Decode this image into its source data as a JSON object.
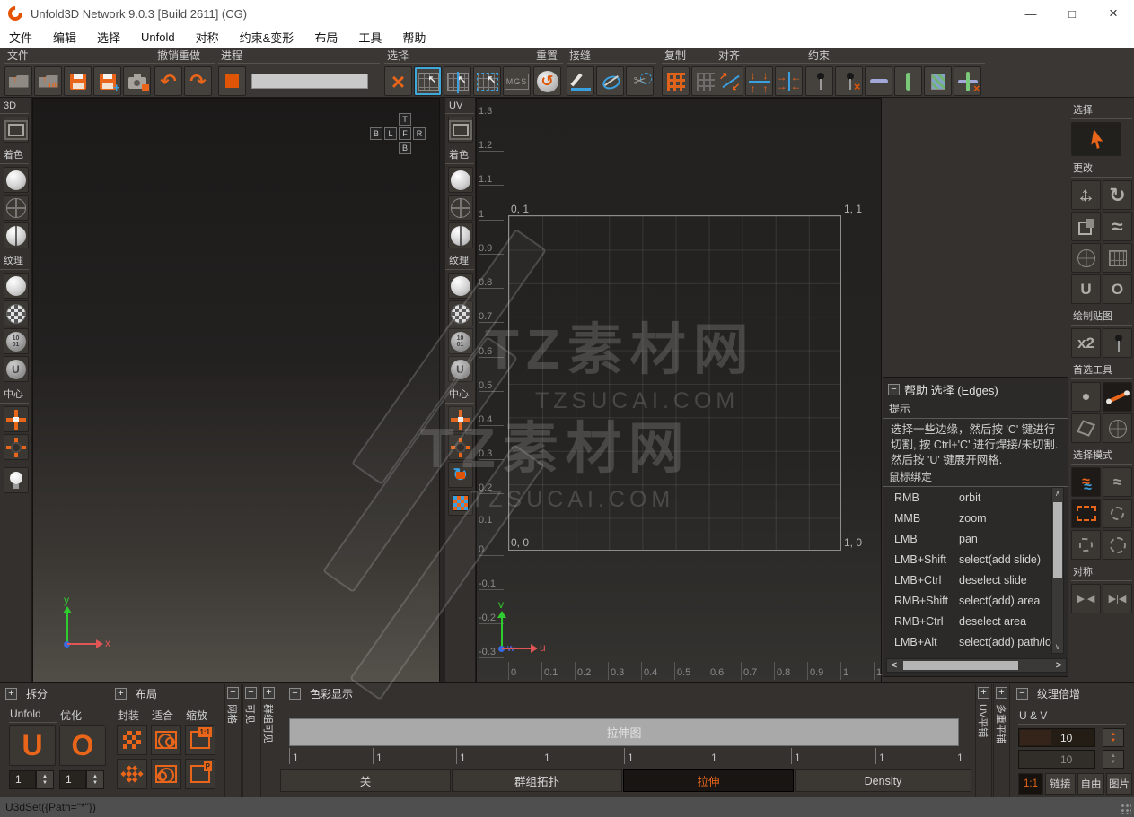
{
  "window": {
    "title": "Unfold3D Network 9.0.3 [Build 2611] (CG)",
    "minimize": "—",
    "maximize": "□",
    "close": "×"
  },
  "menubar": {
    "items": [
      "文件",
      "编辑",
      "选择",
      "Unfold",
      "对称",
      "约束&变形",
      "布局",
      "工具",
      "帮助"
    ]
  },
  "toolbar": {
    "file": {
      "label": "文件"
    },
    "undo_redo": {
      "label": "撤销重做"
    },
    "process": {
      "label": "进程"
    },
    "select": {
      "label": "选择",
      "mgs": "MGS"
    },
    "reset": {
      "label": "重置"
    },
    "seams": {
      "label": "接缝"
    },
    "copy": {
      "label": "复制"
    },
    "align": {
      "label": "对齐"
    },
    "constraint": {
      "label": "约束"
    }
  },
  "strips": {
    "label3d": "3D",
    "labeluv": "UV",
    "shading": "着色",
    "texture": "纹理",
    "center": "中心",
    "bin1": "10",
    "bin2": "01",
    "usphere": "U"
  },
  "viewcube": {
    "t": "T",
    "b1": "B",
    "l": "L",
    "f": "F",
    "r": "R",
    "b2": "B"
  },
  "axis3d": {
    "x": "x",
    "y": "y"
  },
  "axisuv": {
    "u": "u",
    "v": "v",
    "w": "w"
  },
  "uv": {
    "corner_tl": "0, 1",
    "corner_tr": "1, 1",
    "corner_bl": "0, 0",
    "corner_br": "1, 0",
    "yticks": [
      "1.3",
      "1.2",
      "1.1",
      "1",
      "0.9",
      "0.8",
      "0.7",
      "0.6",
      "0.5",
      "0.4",
      "0.3",
      "0.2",
      "0.1",
      "0",
      "-0.1",
      "-0.2",
      "-0.3"
    ],
    "xticks": [
      "0",
      "0.1",
      "0.2",
      "0.3",
      "0.4",
      "0.5",
      "0.6",
      "0.7",
      "0.8",
      "0.9",
      "1",
      "1.1"
    ]
  },
  "watermark": {
    "line1": "TZ素材网",
    "line2": "TZSUCAI.COM"
  },
  "rightbar": {
    "select": "选择",
    "modify": "更改",
    "paint": "绘制贴图",
    "x2": "x2",
    "preferred": "首选工具",
    "selection_mode": "选择模式",
    "symmetry": "对称"
  },
  "help": {
    "title": "帮助 选择 (Edges)",
    "tip_label": "提示",
    "tip_text": "选择一些边缘，然后按 'C' 键进行切割, 按 Ctrl+'C' 进行焊接/未切割. 然后按 'U' 键展开网格.",
    "bindings_label": "鼠标绑定",
    "bindings": [
      {
        "key": "RMB",
        "action": "orbit"
      },
      {
        "key": "MMB",
        "action": "zoom"
      },
      {
        "key": "LMB",
        "action": "pan"
      },
      {
        "key": "LMB+Shift",
        "action": "select(add slide)"
      },
      {
        "key": "LMB+Ctrl",
        "action": "deselect slide"
      },
      {
        "key": "RMB+Shift",
        "action": "select(add) area"
      },
      {
        "key": "RMB+Ctrl",
        "action": "deselect area"
      },
      {
        "key": "LMB+Alt",
        "action": "select(add) path/lo"
      }
    ]
  },
  "bottom": {
    "split": {
      "header": "拆分",
      "tab1": "Unfold",
      "tab2": "优化",
      "unfold_value": "1",
      "optimize_value": "1",
      "u_icon": "U",
      "o_icon": "O"
    },
    "layout": {
      "header": "布局",
      "tab1": "封装",
      "tab2": "适合",
      "tab3": "缩放",
      "badge_11": "1:1",
      "badge_p": "P"
    },
    "vstrips_left": [
      "网格",
      "可见",
      "群组可见"
    ],
    "color_display": {
      "header": "色彩显示",
      "bar_label": "拉伸图",
      "ticks": [
        "1",
        "1",
        "1",
        "1",
        "1",
        "1",
        "1",
        "1",
        "1"
      ],
      "buttons": [
        "关",
        "群组拓扑",
        "拉伸",
        "Density"
      ]
    },
    "vstrips_right": [
      "UV平铺",
      "多重平铺"
    ],
    "texture_mult": {
      "header": "纹理倍增",
      "tab": "U & V",
      "u_value": "10",
      "v_value": "10",
      "buttons": [
        "1:1",
        "链接",
        "自由",
        "图片"
      ]
    }
  },
  "statusbar": {
    "text": "U3dSet({Path=\"*\"})"
  },
  "icons": {
    "arrow_up": "↑",
    "uv_text": "UV",
    "plus": "+",
    "minus": "−",
    "undo": "↶",
    "redo": "↷",
    "cursor": "↖",
    "reset": "↺",
    "scissors": "✂",
    "down": "↓",
    "up": "↑",
    "ne": "↗",
    "sw": "↙",
    "right": "→",
    "left": "←",
    "rotate": "↻",
    "harr": "↔",
    "varr": "↕",
    "wave": "≈",
    "clamp_u": "U",
    "clamp_o": "O",
    "tri_r": "▶",
    "tri_l": "◀",
    "pipe": "|",
    "spin_up": "▲",
    "spin_down": "▼",
    "chev_up": "∧",
    "chev_down": "∨",
    "chev_left": "<",
    "chev_right": ">",
    "x": "×",
    "dot": "·"
  }
}
